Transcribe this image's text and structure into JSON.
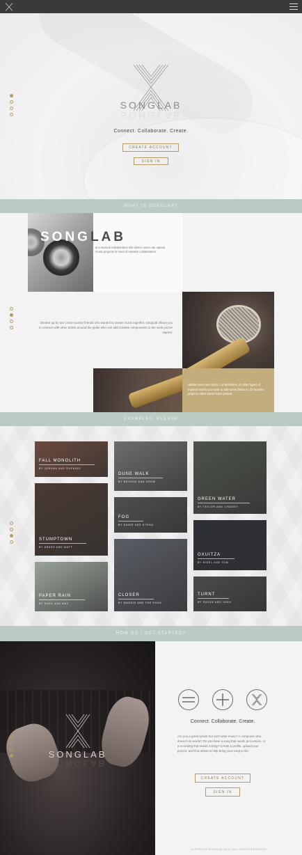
{
  "hero": {
    "brand": "SONGLAB",
    "tagline": "Connect. Collaborate. Create.",
    "create_label": "CREATE ACCOUNT",
    "signin_label": "SIGN IN"
  },
  "about": {
    "band_label": "WHAT IS SONGLAB?",
    "title_light": "SONG",
    "title_dark": "LAB",
    "intro": "is a musical collaboration site where users can upload music projects in need of creative collaboration.",
    "story": "Dreamt up by two cross-country friends who wanted to create music together, songLab allows you to connect with other artists around the globe who can add creative components to the work you've started.",
    "upload": "Upload your own lyrics, compositions, or other types of musical works you want to add some flavor to. Or browse projects other artists have posted."
  },
  "examples": {
    "band_label": "EXAMPLES, PLEASE",
    "tiles": [
      {
        "name": "FALL MONOLITH",
        "by": "BY JORDAN AND RAPHAEL",
        "color": "#6b4a3e"
      },
      {
        "name": "STUMPTOWN",
        "by": "BY ARASH AND MATT",
        "color": "#4a3a32"
      },
      {
        "name": "PAPER RAIN",
        "by": "BY DUKE AND AMY",
        "color": "#9aa49a"
      },
      {
        "name": "DUNE WALK",
        "by": "BY BROOKE AND DREW",
        "color": "#6d6d70"
      },
      {
        "name": "FOG",
        "by": "BY DANIE AND ETHAN",
        "color": "#4e4f52"
      },
      {
        "name": "CLOSER",
        "by": "BY MADDIE AND THE ROAD",
        "color": "#5a5d66"
      },
      {
        "name": "GREEN WATER",
        "by": "BY TAYLOR AND LINDSEY",
        "color": "#4d534a"
      },
      {
        "name": "OXUITZA",
        "by": "BY RIDEL AND TOM",
        "color": "#2e3038"
      },
      {
        "name": "TURNT",
        "by": "BY RAVEN AND JOSH",
        "color": "#4a4a4a"
      }
    ]
  },
  "started": {
    "band_label": "HOW DO I GET STARTED?",
    "brand": "SONGLAB",
    "tagline": "Connect. Collaborate. Create.",
    "text": "Are you a great lyricist but can't write music? A composer who doesn't do words? Do you have a song that needs percussion, or a recording that needs mixing? Create a profile, upload your project, and find artists to help bring your song to life.",
    "create_label": "CREATE ACCOUNT",
    "signin_label": "SIGN IN",
    "copyright": "COPYRIGHT SONGLAB 2015 | ALL RIGHTS RESERVED"
  },
  "colors": {
    "accent": "#b39a67",
    "band": "#b9cbc2",
    "gold": "#c4ad7c"
  }
}
